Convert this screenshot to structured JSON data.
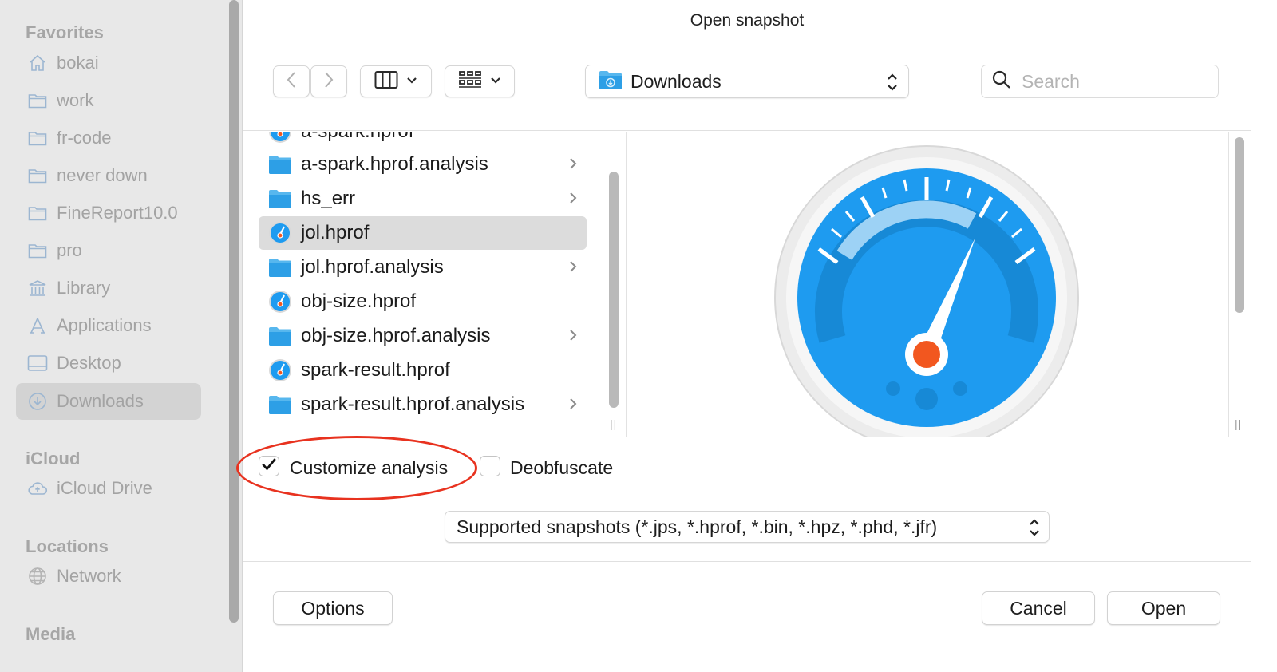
{
  "window": {
    "title": "Open snapshot"
  },
  "sidebar": {
    "sections": [
      {
        "title": "Favorites",
        "items": [
          {
            "label": "bokai",
            "icon": "house-icon"
          },
          {
            "label": "work",
            "icon": "folder-icon"
          },
          {
            "label": "fr-code",
            "icon": "folder-icon"
          },
          {
            "label": "never down",
            "icon": "folder-icon"
          },
          {
            "label": "FineReport10.0",
            "icon": "folder-icon"
          },
          {
            "label": "pro",
            "icon": "folder-icon"
          },
          {
            "label": "Library",
            "icon": "library-icon"
          },
          {
            "label": "Applications",
            "icon": "applications-icon"
          },
          {
            "label": "Desktop",
            "icon": "desktop-icon"
          },
          {
            "label": "Downloads",
            "icon": "downloads-icon",
            "selected": true
          }
        ]
      },
      {
        "title": "iCloud",
        "items": [
          {
            "label": "iCloud Drive",
            "icon": "cloud-icon"
          }
        ]
      },
      {
        "title": "Locations",
        "items": [
          {
            "label": "Network",
            "icon": "globe-icon"
          }
        ]
      },
      {
        "title": "Media",
        "items": []
      }
    ]
  },
  "toolbar": {
    "location": "Downloads",
    "search_placeholder": "Search",
    "view_mode": "columns-view-icon",
    "group_mode": "grid-group-icon"
  },
  "files": [
    {
      "name": "a-spark.hprof",
      "type": "hprof",
      "has_children": false
    },
    {
      "name": "a-spark.hprof.analysis",
      "type": "folder",
      "has_children": true
    },
    {
      "name": "hs_err",
      "type": "folder",
      "has_children": true
    },
    {
      "name": "jol.hprof",
      "type": "hprof",
      "has_children": false,
      "selected": true
    },
    {
      "name": "jol.hprof.analysis",
      "type": "folder",
      "has_children": true
    },
    {
      "name": "obj-size.hprof",
      "type": "hprof",
      "has_children": false
    },
    {
      "name": "obj-size.hprof.analysis",
      "type": "folder",
      "has_children": true
    },
    {
      "name": "spark-result.hprof",
      "type": "hprof",
      "has_children": false
    },
    {
      "name": "spark-result.hprof.analysis",
      "type": "folder",
      "has_children": true
    }
  ],
  "options": {
    "customize_label": "Customize analysis",
    "customize_checked": true,
    "deobfuscate_label": "Deobfuscate",
    "deobfuscate_checked": false
  },
  "filter": {
    "selected": "Supported snapshots (*.jps, *.hprof, *.bin, *.hpz, *.phd, *.jfr)"
  },
  "buttons": {
    "options": "Options",
    "cancel": "Cancel",
    "open": "Open"
  },
  "colors": {
    "accent_blue": "#1e9bf0",
    "highlight_red": "#e8321f",
    "needle_orange": "#f2571f"
  }
}
